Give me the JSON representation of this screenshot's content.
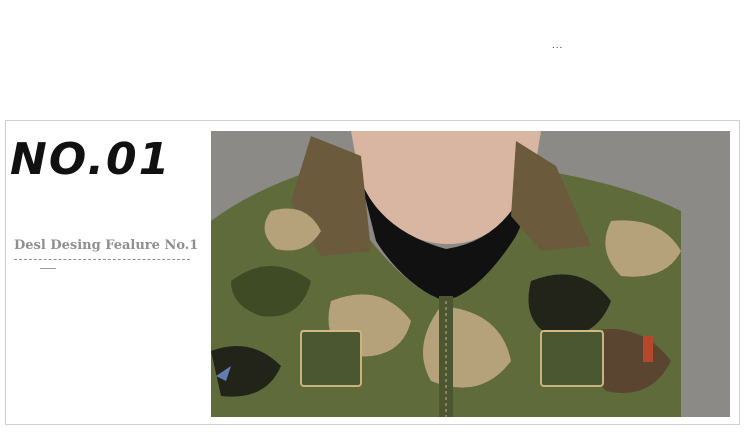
{
  "top_marker": "...",
  "feature": {
    "heading": "NO.01",
    "subheading": "Desl Desing Fealure No.1"
  },
  "photo": {
    "subject": "camouflage-jacket-collar-photo",
    "colors": {
      "background": "#8b8a86",
      "camo_olive": "#5f6b3a",
      "camo_green": "#3f4b24",
      "camo_tan": "#b6a27a",
      "camo_brown": "#5a4530",
      "camo_dark": "#22241a",
      "shirt": "#111111",
      "skin": "#d8b6a2"
    }
  }
}
